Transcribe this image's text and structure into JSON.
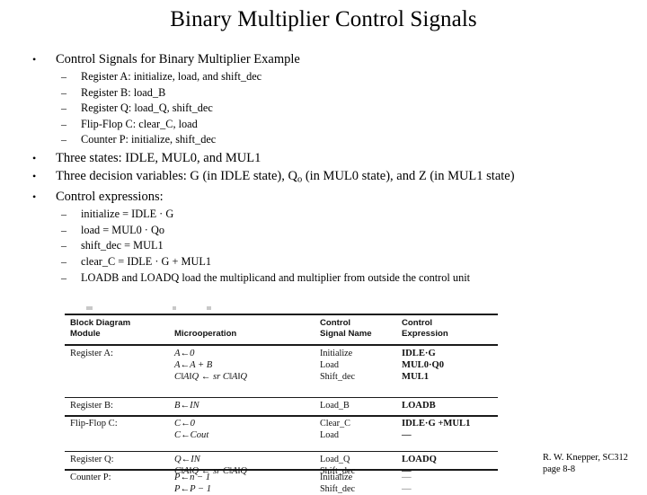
{
  "slide": {
    "title": "Binary Multiplier Control Signals"
  },
  "bullets": {
    "b1": "Control Signals for Binary Multiplier Example",
    "b1_sub": [
      "Register A:  initialize, load, and shift_dec",
      "Register B:  load_B",
      "Register Q:  load_Q, shift_dec",
      "Flip-Flop C:  clear_C, load",
      "Counter P:  initialize, shift_dec"
    ],
    "b2": "Three states:  IDLE, MUL0, and MUL1",
    "b3_pre": "Three decision variables:   G (in IDLE state), Q",
    "b3_sub": "o",
    "b3_post": " (in MUL0 state), and Z (in MUL1 state)",
    "b4": "Control expressions:",
    "b4_sub": [
      "initialize = IDLE · G",
      "load = MUL0 · Qo",
      "shift_dec = MUL1",
      "clear_C = IDLE · G + MUL1",
      "LOADB and LOADQ load the multiplicand and multiplier from outside the control unit"
    ],
    "marker_lvl1": "•",
    "marker_lvl2": "–"
  },
  "table": {
    "headers": {
      "col1_line1": "Block Diagram",
      "col1_line2": "Module",
      "col2": "Microoperation",
      "col3_line1": "Control",
      "col3_line2": "Signal Name",
      "col4_line1": "Control",
      "col4_line2": "Expression"
    },
    "rows": [
      {
        "module": "Register A:",
        "lines": [
          {
            "microoperation": "A←0",
            "signal": "Initialize",
            "expression": "IDLE·G"
          },
          {
            "microoperation": "A←A + B",
            "signal": "Load",
            "expression": "MUL0·Q0"
          },
          {
            "microoperation": "C‖A‖Q ← sr C‖A‖Q",
            "signal": "Shift_dec",
            "expression": "MUL1"
          }
        ]
      },
      {
        "module": "Register B:",
        "lines": [
          {
            "microoperation": "B←IN",
            "signal": "Load_B",
            "expression": "LOADB"
          }
        ]
      },
      {
        "module": "Flip-Flop C:",
        "lines": [
          {
            "microoperation": "C←0",
            "signal": "Clear_C",
            "expression": "IDLE·G +MUL1"
          },
          {
            "microoperation": "C←Cout",
            "signal": "Load",
            "expression": "—"
          }
        ]
      },
      {
        "module": "Register Q:",
        "lines": [
          {
            "microoperation": "Q←IN",
            "signal": "Load_Q",
            "expression": "LOADQ"
          },
          {
            "microoperation": "C‖A‖Q ← sr C‖A‖Q",
            "signal": "Shift_dec",
            "expression": "—"
          }
        ]
      },
      {
        "module": "Counter P:",
        "lines": [
          {
            "microoperation": "P←n − 1",
            "signal": "Initialize",
            "expression": "—"
          },
          {
            "microoperation": "P←P − 1",
            "signal": "Shift_dec",
            "expression": "—"
          }
        ]
      }
    ]
  },
  "credit": {
    "line1": "R. W. Knepper, SC312",
    "line2": "page 8-8"
  }
}
